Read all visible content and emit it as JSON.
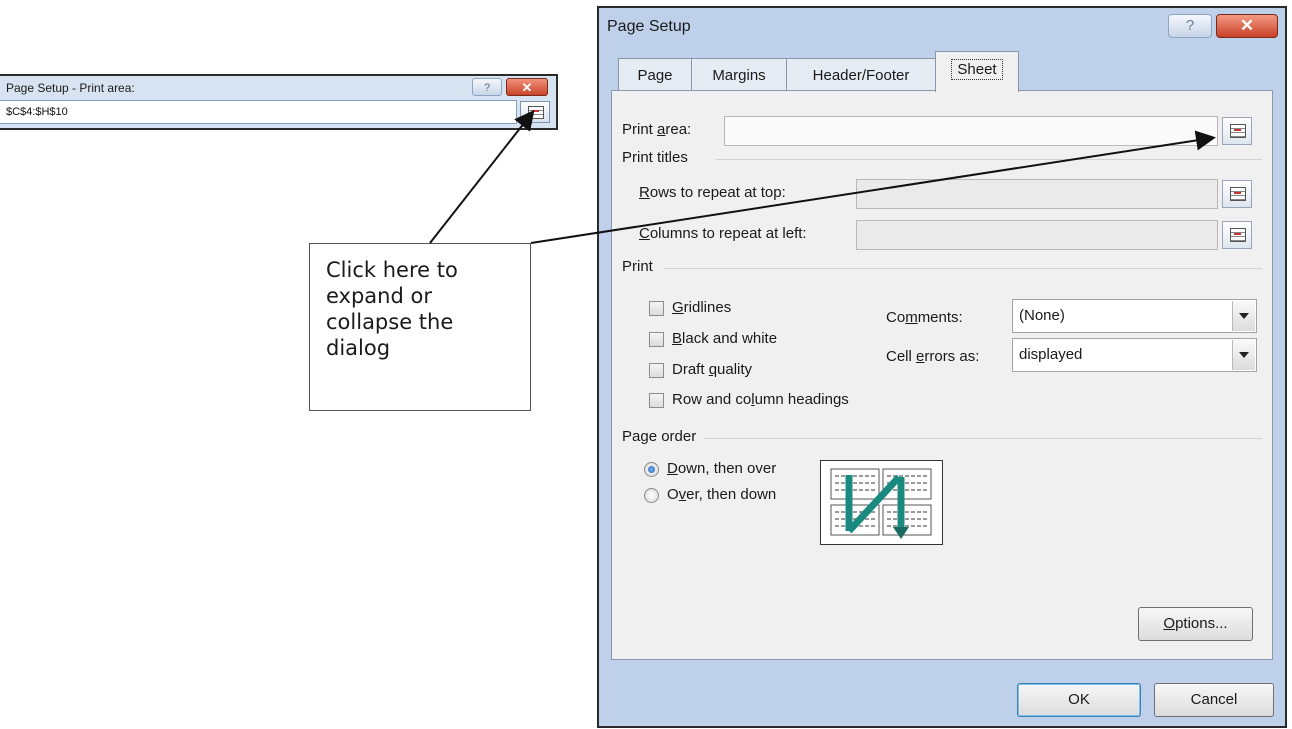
{
  "mini_dialog": {
    "title": "Page Setup - Print area:",
    "help_label": "?",
    "close_label": "✕",
    "range_value": "$C$4:$H$10"
  },
  "callout": {
    "text_lines": [
      "Click here to",
      "expand or",
      "collapse the",
      "dialog"
    ]
  },
  "dialog": {
    "title": "Page Setup",
    "help_label": "?",
    "close_label": "✕",
    "tabs": [
      {
        "label": "Page"
      },
      {
        "label": "Margins"
      },
      {
        "label": "Header/Footer"
      },
      {
        "label": "Sheet"
      }
    ],
    "active_tab": "Sheet",
    "print_area": {
      "label_pre": "Print ",
      "label_key": "a",
      "label_post": "rea:",
      "value": ""
    },
    "print_titles": {
      "heading": "Print titles",
      "rows": {
        "label_key": "R",
        "label_post": "ows to repeat at top:",
        "value": ""
      },
      "columns": {
        "label_key": "C",
        "label_post": "olumns to repeat at left:",
        "value": ""
      }
    },
    "print": {
      "heading": "Print",
      "gridlines": {
        "label_key": "G",
        "label_post": "ridlines",
        "checked": false
      },
      "black_white": {
        "label_key": "B",
        "label_post": "lack and white",
        "checked": false
      },
      "draft": {
        "label_pre": "Draft ",
        "label_key": "q",
        "label_post": "uality",
        "checked": false
      },
      "headings": {
        "label_pre": "Row and co",
        "label_key": "l",
        "label_post": "umn headings",
        "checked": false
      },
      "comments": {
        "label_pre": "Co",
        "label_key": "m",
        "label_post": "ments:",
        "value": "(None)"
      },
      "cell_errors": {
        "label_pre": "Cell ",
        "label_key": "e",
        "label_post": "rrors as:",
        "value": "displayed"
      }
    },
    "page_order": {
      "heading": "Page order",
      "down_over": {
        "label_key": "D",
        "label_post": "own, then over",
        "selected": true
      },
      "over_down": {
        "label_pre": "O",
        "label_key": "v",
        "label_post": "er, then down",
        "selected": false
      }
    },
    "options_button": {
      "label_key": "O",
      "label_post": "ptions..."
    },
    "ok_label": "OK",
    "cancel_label": "Cancel"
  },
  "colors": {
    "dialog_frame": "#bed0ea",
    "panel": "#f0f0f0",
    "close_red": "#c9412a",
    "arrow": "#111111",
    "page_order_teal": "#1a8a80"
  }
}
